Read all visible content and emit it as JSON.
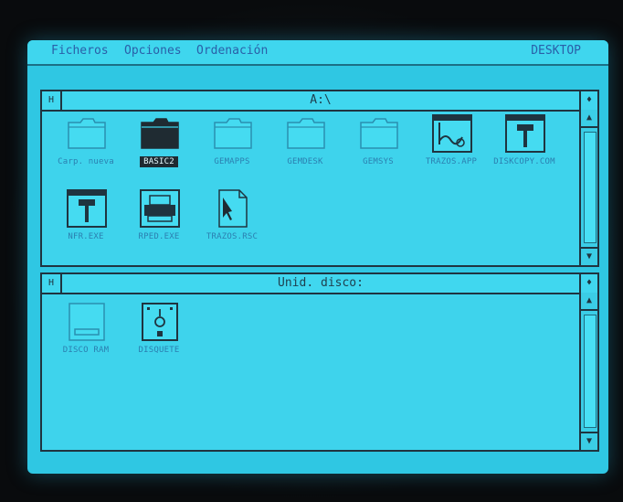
{
  "menubar": {
    "items": [
      "Ficheros",
      "Opciones",
      "Ordenación"
    ],
    "desktop_label": "DESKTOP"
  },
  "window_top": {
    "title": "A:\\",
    "close_glyph": "H",
    "full_glyph": "♦",
    "icons": [
      {
        "label": "Carp. nueva",
        "type": "folder"
      },
      {
        "label": "BASIC2",
        "type": "folder",
        "selected": true
      },
      {
        "label": "GEMAPPS",
        "type": "folder"
      },
      {
        "label": "GEMDESK",
        "type": "folder"
      },
      {
        "label": "GEMSYS",
        "type": "folder"
      },
      {
        "label": "TRAZOS.APP",
        "type": "app"
      },
      {
        "label": "DISKCOPY.COM",
        "type": "tool"
      },
      {
        "label": "NFR.EXE",
        "type": "tool"
      },
      {
        "label": "RPED.EXE",
        "type": "printer"
      },
      {
        "label": "TRAZOS.RSC",
        "type": "document"
      }
    ]
  },
  "window_bottom": {
    "title": "Unid. disco:",
    "close_glyph": "H",
    "full_glyph": "♦",
    "icons": [
      {
        "label": "DISCO RAM",
        "type": "ramdisk"
      },
      {
        "label": "DISQUETE",
        "type": "floppy"
      }
    ]
  },
  "colors": {
    "desktop": "#2fc7e3",
    "window": "#3ed3ec",
    "ink": "#1f3440",
    "label": "#2b7fb0",
    "menu_text": "#2a5fa8"
  }
}
